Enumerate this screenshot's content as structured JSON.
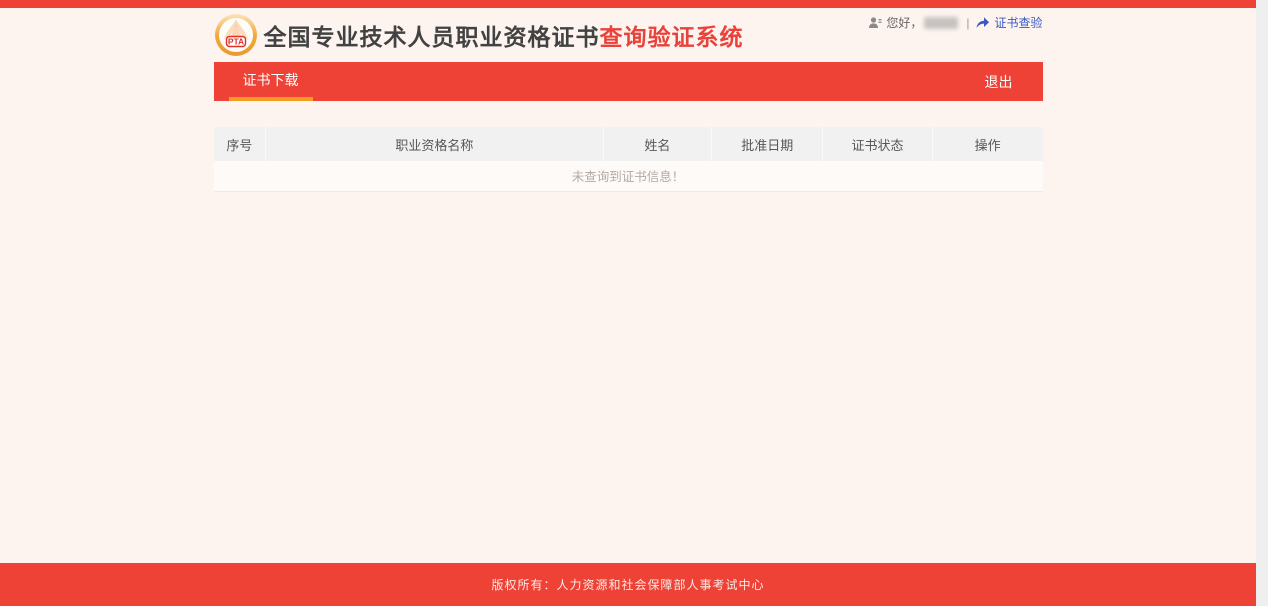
{
  "header": {
    "logo_text": "PTA",
    "title_dark": "全国专业技术人员职业资格证书",
    "title_red": "查询验证系统"
  },
  "user_bar": {
    "greeting": "您好，",
    "separator": "|",
    "verify_link_label": "证书查验"
  },
  "nav": {
    "tabs": [
      {
        "label": "证书下载",
        "active": true
      }
    ],
    "logout_label": "退出"
  },
  "table": {
    "columns": [
      "序号",
      "职业资格名称",
      "姓名",
      "批准日期",
      "证书状态",
      "操作"
    ],
    "empty_message": "未查询到证书信息！"
  },
  "footer": {
    "copyright": "版权所有：人力资源和社会保障部人事考试中心"
  },
  "colors": {
    "primary_red": "#ee4237",
    "accent_orange": "#f59a23",
    "link_blue": "#3a57c4",
    "page_background": "#fdf4ef",
    "table_header_bg": "#f1f1f1"
  }
}
